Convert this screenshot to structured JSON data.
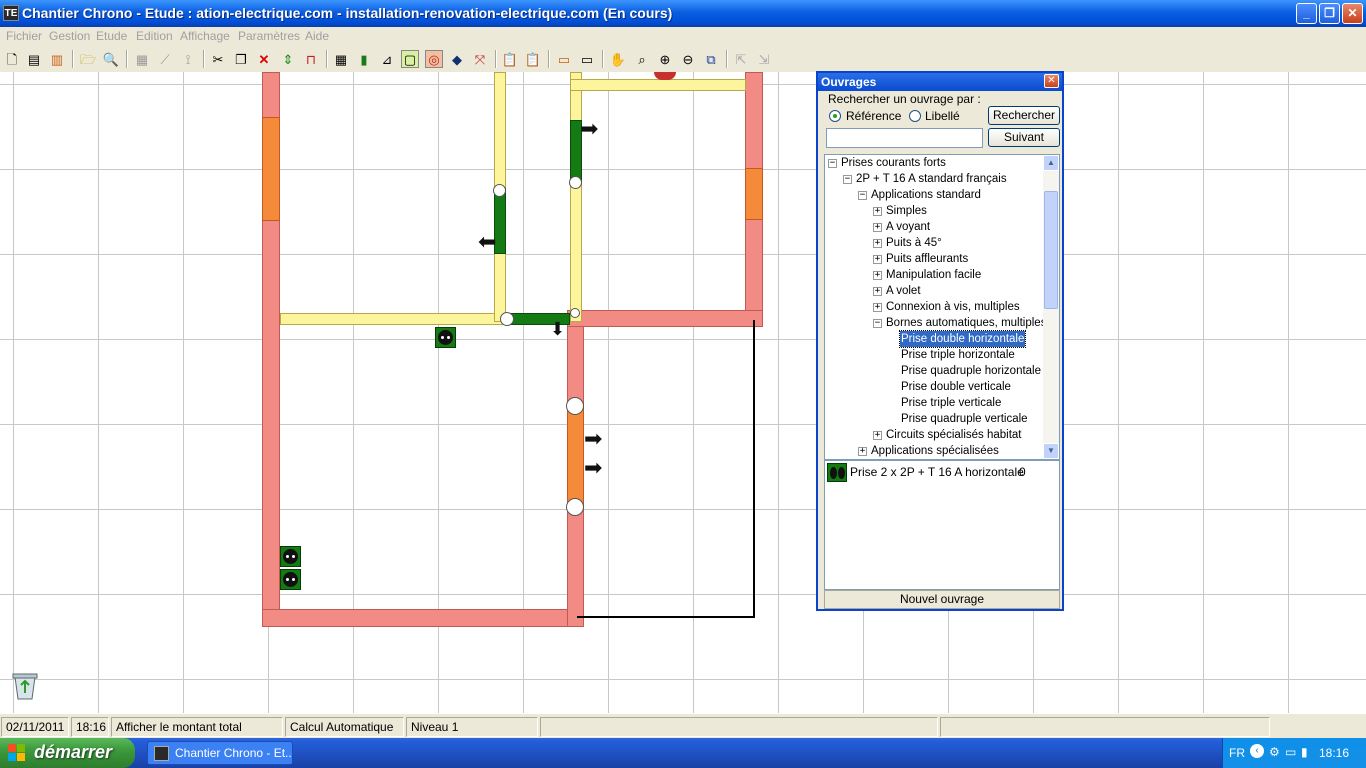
{
  "window": {
    "app_icon": "TE",
    "title": "Chantier Chrono - Etude : ation-electrique.com - installation-renovation-electrique.com (En cours)",
    "minimize_icon": "_",
    "maximize_icon": "❐",
    "close_icon": "✕"
  },
  "menu": [
    "Fichier",
    "Gestion",
    "Etude",
    "Edition",
    "Affichage",
    "Paramètres",
    "Aide"
  ],
  "toolbar_icons": [
    "new-doc-icon",
    "doc-list-icon",
    "building-icon",
    "open-folder-icon",
    "print-preview-icon",
    "table-icon",
    "chart-icon",
    "chart2-icon",
    "cut-icon",
    "copy-icon",
    "delete-icon",
    "move-vertical-icon",
    "room-icon",
    "grid-icon",
    "door-icon",
    "wall-icon",
    "layer-icon",
    "circle-target-icon",
    "diamond-icon",
    "cross-arrows-icon",
    "clipboard-icon",
    "clipboard2-icon",
    "tray-icon",
    "tray2-icon",
    "hand-icon",
    "search-icon",
    "zoom-in-icon",
    "zoom-out-icon",
    "zoom-fit-icon",
    "export-icon",
    "import-icon"
  ],
  "panel": {
    "title": "Ouvrages",
    "close_icon": "✕",
    "search_label": "Rechercher un ouvrage par :",
    "radio_reference": "Référence",
    "radio_libelle": "Libellé",
    "search_value": "",
    "search_button": "Rechercher",
    "next_button": "Suivant",
    "tree": [
      {
        "label": "Prises courants forts",
        "state": "−"
      },
      {
        "label": "2P + T 16 A standard français",
        "state": "−"
      },
      {
        "label": "Applications standard",
        "state": "−"
      },
      {
        "label": "Simples",
        "state": "+"
      },
      {
        "label": "A voyant",
        "state": "+"
      },
      {
        "label": "Puits à 45°",
        "state": "+"
      },
      {
        "label": "Puits affleurants",
        "state": "+"
      },
      {
        "label": "Manipulation facile",
        "state": "+"
      },
      {
        "label": "A volet",
        "state": "+"
      },
      {
        "label": "Connexion à vis, multiples",
        "state": "+"
      },
      {
        "label": "Bornes automatiques, multiples",
        "state": "−"
      },
      {
        "label": "Prise double horizontale",
        "state": ""
      },
      {
        "label": "Prise triple horizontale",
        "state": ""
      },
      {
        "label": "Prise quadruple horizontale",
        "state": ""
      },
      {
        "label": "Prise double verticale",
        "state": ""
      },
      {
        "label": "Prise triple verticale",
        "state": ""
      },
      {
        "label": "Prise quadruple verticale",
        "state": ""
      },
      {
        "label": "Circuits spécialisés habitat",
        "state": "+"
      },
      {
        "label": "Applications spécialisées",
        "state": "+"
      }
    ],
    "selected_item": "Prise double horizontale",
    "detail_label": "Prise 2 x 2P + T 16 A horizontale",
    "detail_count": "0",
    "new_button": "Nouvel ouvrage",
    "scroll_up": "▲",
    "scroll_down": "▼"
  },
  "status": {
    "date": "02/11/2011",
    "time": "18:16",
    "total": "Afficher le montant total",
    "calc": "Calcul Automatique",
    "level": "Niveau 1"
  },
  "taskbar": {
    "start": "démarrer",
    "task": "Chantier Chrono - Et...",
    "lang": "FR",
    "clock": "18:16"
  },
  "colors": {
    "wall": "#f28b84",
    "yellow_line": "#fdf59c",
    "door": "#f58a3b",
    "equipment": "#147a14",
    "selection": "#316ac5"
  }
}
